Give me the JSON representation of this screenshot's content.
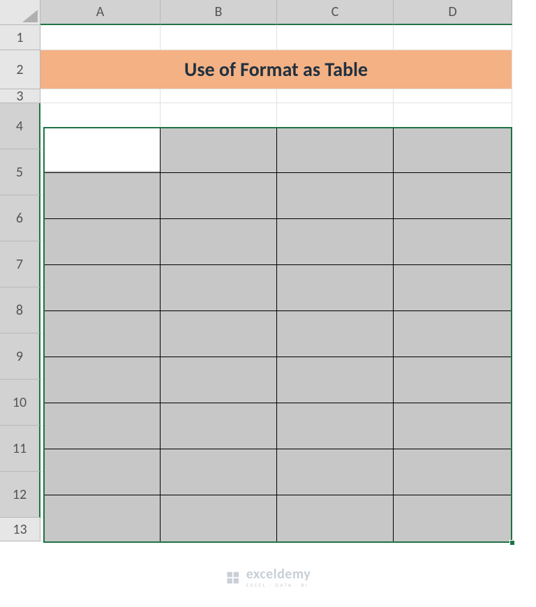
{
  "columns": [
    "A",
    "B",
    "C",
    "D"
  ],
  "rows": [
    "1",
    "2",
    "3",
    "4",
    "5",
    "6",
    "7",
    "8",
    "9",
    "10",
    "11",
    "12",
    "13"
  ],
  "title_cell": "Use of Format as Table",
  "selection": {
    "start": "A4",
    "end": "D12",
    "active": "A4"
  },
  "watermark": {
    "name": "exceldemy",
    "tagline": "EXCEL · DATA · BI"
  },
  "colors": {
    "banner_bg": "#f4b183",
    "selection_border": "#1f7246",
    "selection_fill": "#c7c7c7",
    "header_bg": "#e6e6e6"
  }
}
